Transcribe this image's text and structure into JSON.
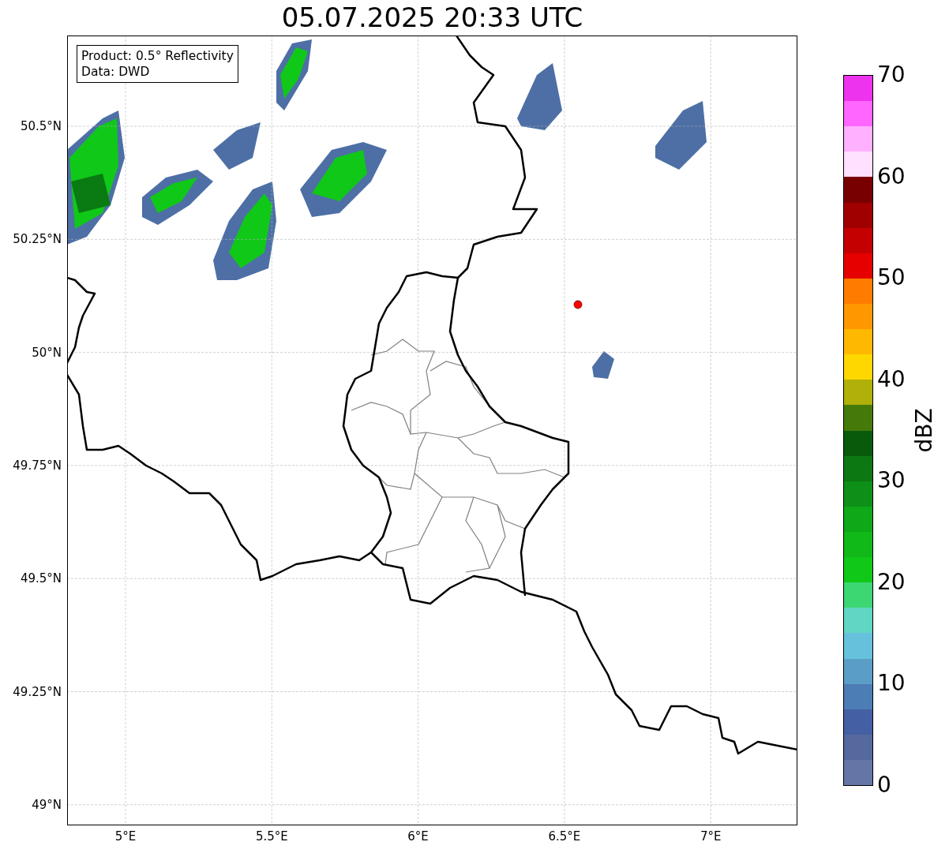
{
  "title": "05.07.2025 20:33 UTC",
  "info_box": {
    "lines": [
      "Product: 0.5° Reflectivity",
      "Data: DWD"
    ]
  },
  "latitude_ticks": [
    "50.5°N",
    "50.25°N",
    "50°N",
    "49.75°N",
    "49.5°N",
    "49.25°N",
    "49°N"
  ],
  "longitude_ticks": [
    "5°E",
    "5.5°E",
    "6°E",
    "6.5°E",
    "7°E"
  ],
  "colorbar": {
    "label": "dBZ",
    "ticks": [
      "70",
      "60",
      "50",
      "40",
      "30",
      "20",
      "10",
      "0"
    ],
    "bands": [
      {
        "color": "#6575a6"
      },
      {
        "color": "#55699f"
      },
      {
        "color": "#445fa3"
      },
      {
        "color": "#4d7db5"
      },
      {
        "color": "#5a9ec8"
      },
      {
        "color": "#66c2dc"
      },
      {
        "color": "#62d6c4"
      },
      {
        "color": "#3cd672"
      },
      {
        "color": "#10c818"
      },
      {
        "color": "#10b818"
      },
      {
        "color": "#0ea818"
      },
      {
        "color": "#0e9018"
      },
      {
        "color": "#0c7812"
      },
      {
        "color": "#0a5a0c"
      },
      {
        "color": "#457a0a"
      },
      {
        "color": "#b0b00a"
      },
      {
        "color": "#ffd700"
      },
      {
        "color": "#ffb800"
      },
      {
        "color": "#ff9800"
      },
      {
        "color": "#ff7c00"
      },
      {
        "color": "#e60000"
      },
      {
        "color": "#c40000"
      },
      {
        "color": "#a00000"
      },
      {
        "color": "#780000"
      },
      {
        "color": "#ffe0ff"
      },
      {
        "color": "#ffb0ff"
      },
      {
        "color": "#ff66ff"
      },
      {
        "color": "#ee33ee"
      }
    ]
  }
}
